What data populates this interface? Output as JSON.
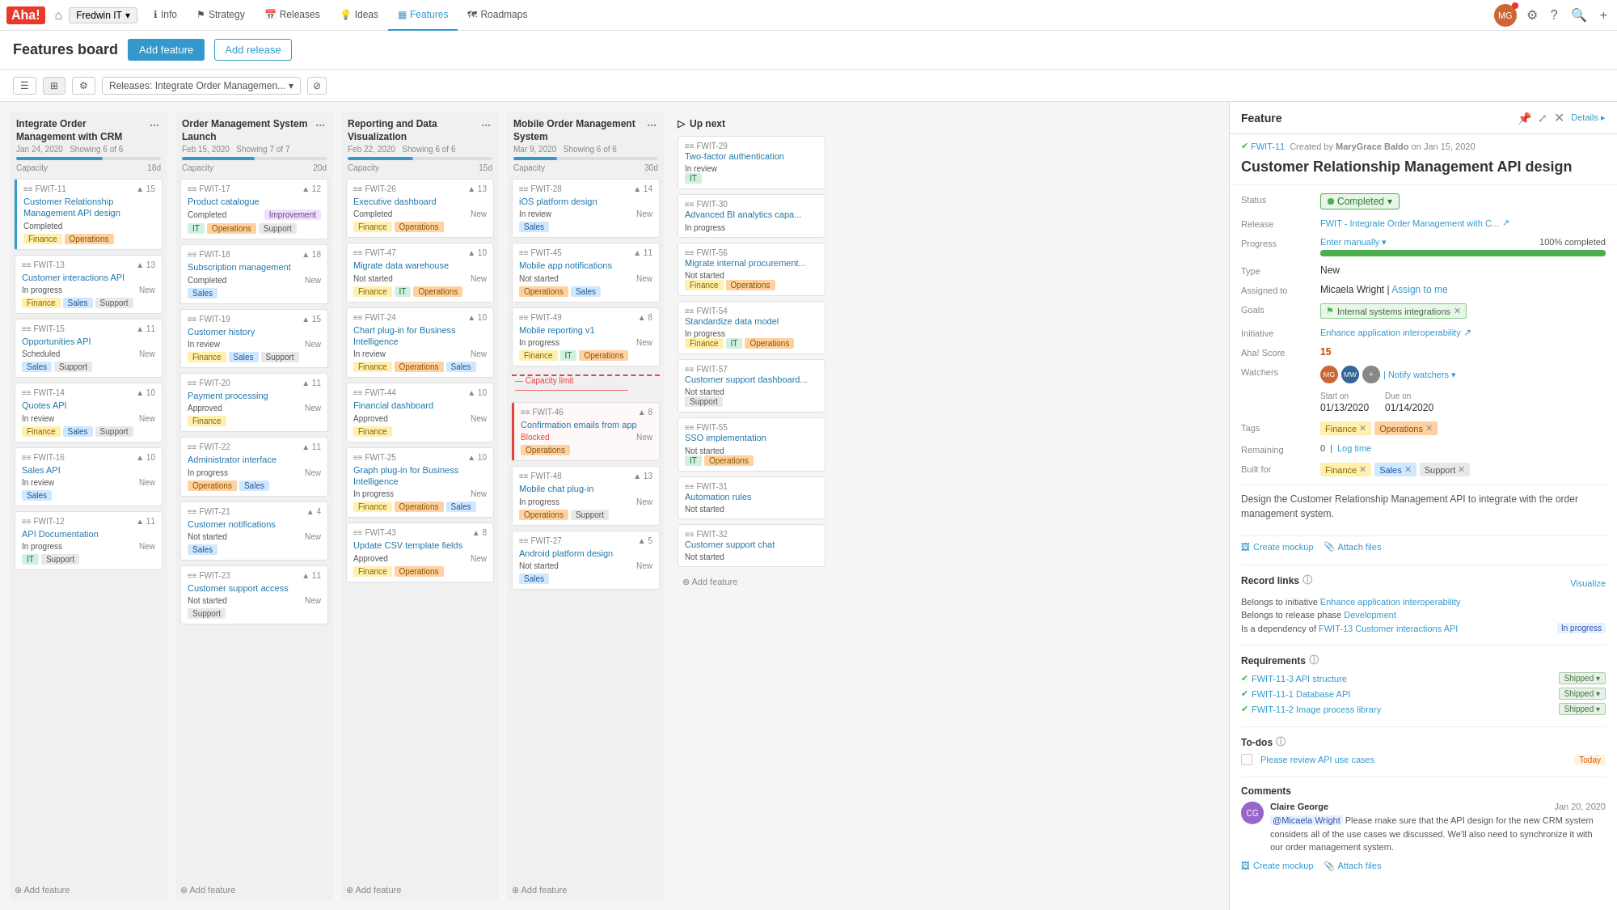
{
  "app": {
    "logo": "Aha!",
    "workspace": "Fredwin IT",
    "nav_tabs": [
      {
        "id": "info",
        "label": "Info",
        "icon": "ℹ️",
        "active": false
      },
      {
        "id": "strategy",
        "label": "Strategy",
        "icon": "⚑",
        "active": false
      },
      {
        "id": "releases",
        "label": "Releases",
        "icon": "📅",
        "active": false
      },
      {
        "id": "ideas",
        "label": "Ideas",
        "icon": "💡",
        "active": false
      },
      {
        "id": "features",
        "label": "Features",
        "icon": "▦",
        "active": true
      },
      {
        "id": "roadmaps",
        "label": "Roadmaps",
        "icon": "🗺",
        "active": false
      }
    ]
  },
  "page": {
    "title": "Features board",
    "add_feature_btn": "Add feature",
    "add_release_btn": "Add release",
    "release_filter": "Releases: Integrate Order Managemen...",
    "view_modes": [
      "list",
      "grid",
      "settings"
    ]
  },
  "columns": [
    {
      "id": "col1",
      "title": "Integrate Order Management with CRM",
      "date": "Jan 24, 2020",
      "showing": "Showing 6 of 6",
      "capacity_label": "Capacity",
      "capacity_days": "18d",
      "progress": 60,
      "cards": [
        {
          "id": "FWIT-11",
          "title": "Customer Relationship Management API design",
          "status": "Completed",
          "is_new": false,
          "score": 15,
          "tags": [
            "Finance",
            "Operations"
          ],
          "highlight": true,
          "blocked": false
        },
        {
          "id": "FWIT-13",
          "title": "Customer interactions API",
          "status": "In progress",
          "is_new": "New",
          "score": 13,
          "tags": [
            "Finance",
            "Sales",
            "Support"
          ],
          "highlight": false,
          "blocked": false
        },
        {
          "id": "FWIT-15",
          "title": "Opportunities API",
          "status": "Scheduled",
          "is_new": "New",
          "score": 11,
          "tags": [
            "Sales",
            "Support"
          ],
          "highlight": false,
          "blocked": false
        },
        {
          "id": "FWIT-14",
          "title": "Quotes API",
          "status": "In review",
          "is_new": "New",
          "score": 10,
          "tags": [
            "Finance",
            "Sales",
            "Support"
          ],
          "highlight": false,
          "blocked": false
        },
        {
          "id": "FWIT-16",
          "title": "Sales API",
          "status": "In review",
          "is_new": "New",
          "score": 10,
          "tags": [
            "Sales"
          ],
          "highlight": false,
          "blocked": false
        },
        {
          "id": "FWIT-12",
          "title": "API Documentation",
          "status": "In progress",
          "is_new": "New",
          "score": 11,
          "tags": [
            "IT",
            "Support"
          ],
          "highlight": false,
          "blocked": false
        }
      ]
    },
    {
      "id": "col2",
      "title": "Order Management System Launch",
      "date": "Feb 15, 2020",
      "showing": "Showing 7 of 7",
      "capacity_label": "Capacity",
      "capacity_days": "20d",
      "progress": 50,
      "cards": [
        {
          "id": "FWIT-17",
          "title": "Product catalogue",
          "status": "Completed",
          "status_badge": "Improvement",
          "is_new": false,
          "score": 12,
          "tags": [
            "IT",
            "Operations",
            "Support"
          ],
          "highlight": false,
          "blocked": false
        },
        {
          "id": "FWIT-18",
          "title": "Subscription management",
          "status": "Completed",
          "is_new": "New",
          "score": 18,
          "tags": [
            "Sales"
          ],
          "highlight": false,
          "blocked": false
        },
        {
          "id": "FWIT-19",
          "title": "Customer history",
          "status": "In review",
          "is_new": "New",
          "score": 15,
          "tags": [
            "Finance",
            "Sales",
            "Support"
          ],
          "highlight": false,
          "blocked": false
        },
        {
          "id": "FWIT-20",
          "title": "Payment processing",
          "status": "Approved",
          "is_new": "New",
          "score": 11,
          "tags": [
            "Finance"
          ],
          "highlight": false,
          "blocked": false
        },
        {
          "id": "FWIT-22",
          "title": "Administrator interface",
          "status": "In progress",
          "is_new": "New",
          "score": 11,
          "tags": [
            "Operations",
            "Sales"
          ],
          "highlight": false,
          "blocked": false
        },
        {
          "id": "FWIT-21",
          "title": "Customer notifications",
          "status": "Not started",
          "is_new": "New",
          "score": 4,
          "tags": [
            "Sales"
          ],
          "highlight": false,
          "blocked": false
        },
        {
          "id": "FWIT-23",
          "title": "Customer support access",
          "status": "Not started",
          "is_new": "New",
          "score": 11,
          "tags": [
            "Support"
          ],
          "highlight": false,
          "blocked": false
        }
      ]
    },
    {
      "id": "col3",
      "title": "Reporting and Data Visualization",
      "date": "Feb 22, 2020",
      "showing": "Showing 6 of 6",
      "capacity_label": "Capacity",
      "capacity_days": "15d",
      "progress": 45,
      "cards": [
        {
          "id": "FWIT-26",
          "title": "Executive dashboard",
          "status": "Completed",
          "is_new": "New",
          "score": 13,
          "tags": [
            "Finance",
            "Operations"
          ],
          "highlight": false,
          "blocked": false
        },
        {
          "id": "FWIT-47",
          "title": "Migrate data warehouse",
          "status": "Not started",
          "is_new": "New",
          "score": 10,
          "tags": [
            "Finance",
            "IT",
            "Operations"
          ],
          "highlight": false,
          "blocked": false
        },
        {
          "id": "FWIT-24",
          "title": "Chart plug-in for Business Intelligence",
          "status": "In review",
          "is_new": "New",
          "score": 10,
          "tags": [
            "Finance",
            "Operations",
            "Sales"
          ],
          "highlight": false,
          "blocked": false
        },
        {
          "id": "FWIT-44",
          "title": "Financial dashboard",
          "status": "Approved",
          "is_new": "New",
          "score": 10,
          "tags": [
            "Finance"
          ],
          "highlight": false,
          "blocked": false
        },
        {
          "id": "FWIT-25",
          "title": "Graph plug-in for Business Intelligence",
          "status": "In progress",
          "is_new": "New",
          "score": 10,
          "tags": [
            "Finance",
            "Operations",
            "Sales"
          ],
          "highlight": false,
          "blocked": false
        },
        {
          "id": "FWIT-43",
          "title": "Update CSV template fields",
          "status": "Approved",
          "is_new": "New",
          "score": 8,
          "tags": [
            "Finance",
            "Operations"
          ],
          "highlight": false,
          "blocked": false
        }
      ]
    },
    {
      "id": "col4",
      "title": "Mobile Order Management System",
      "date": "Mar 9, 2020",
      "showing": "Showing 6 of 6",
      "capacity_label": "Capacity",
      "capacity_days": "30d",
      "progress": 30,
      "capacity_limit_after": 4,
      "cards": [
        {
          "id": "FWIT-28",
          "title": "iOS platform design",
          "status": "In review",
          "is_new": "New",
          "score": 14,
          "tags": [
            "Sales"
          ],
          "highlight": false,
          "blocked": false
        },
        {
          "id": "FWIT-45",
          "title": "Mobile app notifications",
          "status": "Not started",
          "is_new": "New",
          "score": 11,
          "tags": [
            "Operations",
            "Sales"
          ],
          "highlight": false,
          "blocked": false
        },
        {
          "id": "FWIT-49",
          "title": "Mobile reporting v1",
          "status": "In progress",
          "is_new": "New",
          "score": 8,
          "tags": [
            "Finance",
            "IT",
            "Operations"
          ],
          "highlight": false,
          "blocked": false
        },
        {
          "id": "FWIT-46",
          "title": "Confirmation emails from app",
          "status": "Blocked",
          "is_new": "New",
          "score": 8,
          "tags": [
            "Operations"
          ],
          "highlight": false,
          "blocked": true
        },
        {
          "id": "FWIT-48",
          "title": "Mobile chat plug-in",
          "status": "In progress",
          "is_new": "New",
          "score": 13,
          "tags": [
            "Operations",
            "Support"
          ],
          "highlight": false,
          "blocked": false
        },
        {
          "id": "FWIT-27",
          "title": "Android platform design",
          "status": "Not started",
          "is_new": "New",
          "score": 5,
          "tags": [
            "Sales"
          ],
          "highlight": false,
          "blocked": false
        }
      ]
    }
  ],
  "up_next": {
    "title": "Up next",
    "cards": [
      {
        "id": "FWIT-29",
        "title": "Two-factor authentication",
        "status": "In review",
        "tags": [
          "IT"
        ]
      },
      {
        "id": "FWIT-30",
        "title": "Advanced BI analytics capa...",
        "status": "In progress",
        "tags": []
      },
      {
        "id": "FWIT-56",
        "title": "Migrate internal procurement...",
        "status": "Not started",
        "tags": [
          "Finance",
          "Operations"
        ]
      },
      {
        "id": "FWIT-54",
        "title": "Standardize data model",
        "status": "In progress",
        "tags": [
          "Finance",
          "IT",
          "Operations"
        ]
      },
      {
        "id": "FWIT-57",
        "title": "Customer support dashboard...",
        "status": "Not started",
        "tags": [
          "Support"
        ]
      },
      {
        "id": "FWIT-55",
        "title": "SSO implementation",
        "status": "Not started",
        "tags": [
          "IT",
          "Operations"
        ]
      },
      {
        "id": "FWIT-31",
        "title": "Automation rules",
        "status": "Not started",
        "tags": []
      },
      {
        "id": "FWIT-32",
        "title": "Customer support chat",
        "status": "Not started",
        "tags": []
      }
    ]
  },
  "feature_panel": {
    "title": "Feature",
    "details_btn": "Details ▸",
    "id": "FWIT-11",
    "created_by": "MaryGrace Baldo",
    "created_date": "Jan 15, 2020",
    "feature_title": "Customer Relationship Management API design",
    "status": "Completed",
    "release": "FWIT - Integrate Order Management with C...",
    "assigned_to": "Micaela Wright",
    "assign_me_link": "Assign to me",
    "goals_label": "Goals",
    "goals": "Internal systems integrations",
    "initiative": "Enhance application interoperability",
    "aha_score": "15",
    "start_on": "01/13/2020",
    "due_on": "01/14/2020",
    "tags": [
      "Finance",
      "Operations"
    ],
    "remaining": "0",
    "log_time_link": "Log time",
    "built_for": [
      "Finance",
      "Sales",
      "Support"
    ],
    "type": "New",
    "progress_pct": "100% completed",
    "progress_value": 100,
    "description": "Design the Customer Relationship Management API to integrate with the order management system.",
    "create_mockup_btn": "Create mockup",
    "attach_files_btn": "Attach files",
    "record_links_title": "Record links",
    "visualize_link": "Visualize",
    "record_links": [
      {
        "type": "Belongs to initiative",
        "link": "Enhance application interoperability"
      },
      {
        "type": "Belongs to release phase",
        "link": "Development"
      },
      {
        "type": "Is a dependency of",
        "link": "FWIT-13 Customer interactions API",
        "status": "In progress"
      }
    ],
    "requirements_title": "Requirements",
    "requirements": [
      {
        "id": "FWIT-11-3",
        "title": "API structure",
        "status": "Shipped"
      },
      {
        "id": "FWIT-11-1",
        "title": "Database API",
        "status": "Shipped"
      },
      {
        "id": "FWIT-11-2",
        "title": "Image process library",
        "status": "Shipped"
      }
    ],
    "todos_title": "To-dos",
    "todos": [
      {
        "title": "Please review API use cases",
        "due": "Today"
      }
    ],
    "comments_title": "Comments",
    "comments": [
      {
        "author": "Claire George",
        "date": "Jan 20, 2020",
        "avatar_initials": "CG",
        "text": "@Micaela Wright Please make sure that the API design for the new CRM system considers all of the use cases we discussed. We'll also need to synchronize it with our order management system.",
        "mention": "@Micaela Wright"
      }
    ],
    "comment_create_mockup": "Create mockup",
    "comment_attach_files": "Attach files"
  }
}
